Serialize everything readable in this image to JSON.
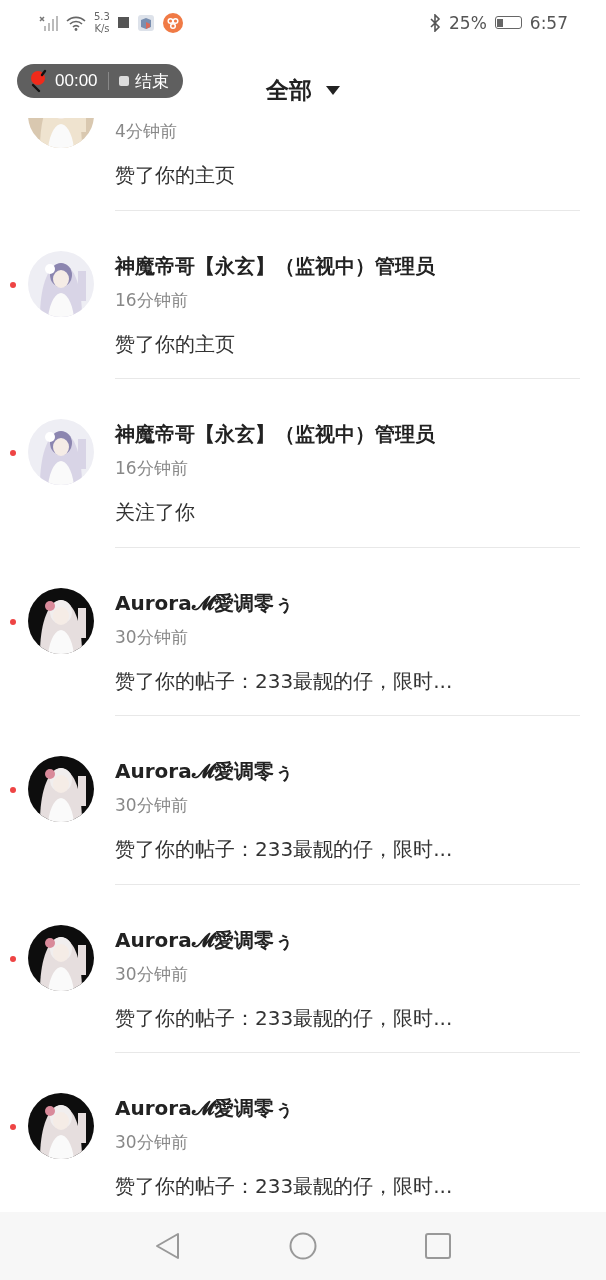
{
  "status_bar": {
    "speed": "5.3",
    "speed_unit": "K/s",
    "battery_text": "25%",
    "time": "6:57"
  },
  "recorder": {
    "time": "00:00",
    "stop_label": "结束"
  },
  "header": {
    "title": "全部"
  },
  "notifications": [
    {
      "unread": false,
      "time": "4分钟前",
      "action": "赞了你的主页"
    },
    {
      "unread": true,
      "name": "神魔帝哥【永玄】（监视中）管理员",
      "time": "16分钟前",
      "action": "赞了你的主页"
    },
    {
      "unread": true,
      "name": "神魔帝哥【永玄】（监视中）管理员",
      "time": "16分钟前",
      "action": "关注了你"
    },
    {
      "unread": true,
      "name": "Aurora𝓜愛调零ぅ",
      "time": "30分钟前",
      "action": "赞了你的帖子：233最靓的仔，限时..."
    },
    {
      "unread": true,
      "name": "Aurora𝓜愛调零ぅ",
      "time": "30分钟前",
      "action": "赞了你的帖子：233最靓的仔，限时..."
    },
    {
      "unread": true,
      "name": "Aurora𝓜愛调零ぅ",
      "time": "30分钟前",
      "action": "赞了你的帖子：233最靓的仔，限时..."
    },
    {
      "unread": true,
      "name": "Aurora𝓜愛调零ぅ",
      "time": "30分钟前",
      "action": "赞了你的帖子：233最靓的仔，限时..."
    }
  ]
}
